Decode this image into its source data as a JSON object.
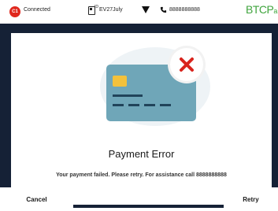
{
  "status_bar": {
    "connection_badge": "C1",
    "connection_status": "Connected",
    "vehicle_sup": "ID",
    "vehicle_id": "EV27July",
    "phone_number": "8888888888",
    "brand_logo": "BTCPa",
    "brand_color": "#3fa43d",
    "status_color": "#e0281e"
  },
  "error": {
    "title": "Payment Error",
    "message": "Your payment failed. Please retry. For assistance call 8888888888"
  },
  "buttons": {
    "cancel_label": "Cancel",
    "retry_label": "Retry"
  },
  "icons": {
    "card": "credit-card-icon",
    "error_badge": "error-x-icon",
    "vehicle": "vehicle-id-icon",
    "signal": "signal-triangle-icon",
    "phone": "phone-icon"
  },
  "colors": {
    "background": "#152136",
    "card": "#6fa6b8",
    "chip": "#f3c13b",
    "error_x": "#d9241d"
  }
}
